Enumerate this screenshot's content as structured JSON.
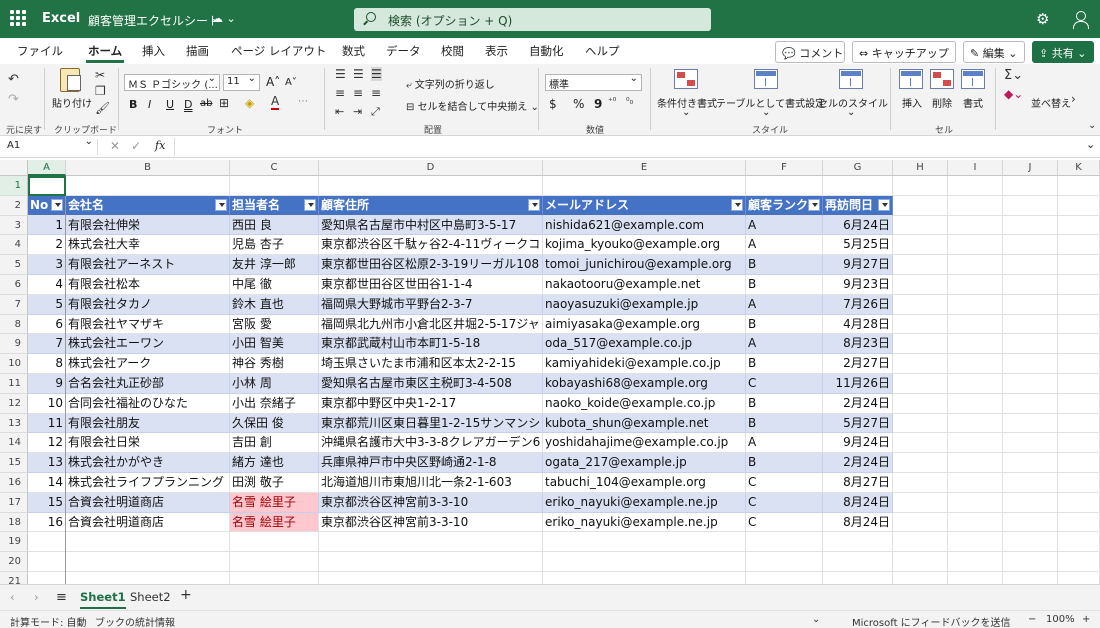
{
  "titlebar": {
    "app_name": "Excel",
    "doc_title": "顧客管理エクセルシート",
    "search_placeholder": "検索 (オプション + Q)",
    "icons": [
      "waffle-icon",
      "cloud-save-icon",
      "chevron-down-icon",
      "search-icon",
      "gear-icon",
      "user-icon"
    ]
  },
  "menu": {
    "items": [
      "ファイル",
      "ホーム",
      "挿入",
      "描画",
      "ページ レイアウト",
      "数式",
      "データ",
      "校閲",
      "表示",
      "自動化",
      "ヘルプ"
    ],
    "active": "ホーム",
    "comment_label": "コメント",
    "catchup_label": "キャッチアップ",
    "edit_label": "編集",
    "share_label": "共有"
  },
  "ribbon": {
    "undo_group": "元に戻す",
    "paste_label": "貼り付け",
    "clipboard_group": "クリップボード",
    "font_name": "ＭＳ Ｐゴシック (...",
    "font_size": "11",
    "font_group": "フォント",
    "wrap_text": "文字列の折り返し",
    "merge_center": "セルを結合して中央揃え",
    "alignment_group": "配置",
    "number_format": "標準",
    "number_group": "数値",
    "cond_format": "条件付き書式",
    "format_table": "テーブルとして書式設定",
    "cell_styles": "セルのスタイル",
    "style_group": "スタイル",
    "insert": "挿入",
    "delete": "削除",
    "format": "書式",
    "cells_group": "セル",
    "sort_filter": "並べ替え",
    "font_buttons": [
      "B",
      "I",
      "U",
      "D",
      "ab"
    ],
    "number_buttons": [
      "$",
      "%",
      "9"
    ]
  },
  "formula_bar": {
    "name_box": "A1",
    "fx": "fx",
    "content": ""
  },
  "columns": [
    {
      "letter": "A",
      "header": "No"
    },
    {
      "letter": "B",
      "header": "会社名"
    },
    {
      "letter": "C",
      "header": "担当者名"
    },
    {
      "letter": "D",
      "header": "顧客住所"
    },
    {
      "letter": "E",
      "header": "メールアドレス"
    },
    {
      "letter": "F",
      "header": "顧客ランク"
    },
    {
      "letter": "G",
      "header": "再訪問日"
    },
    {
      "letter": "H",
      "header": ""
    },
    {
      "letter": "I",
      "header": ""
    },
    {
      "letter": "J",
      "header": ""
    },
    {
      "letter": "K",
      "header": ""
    }
  ],
  "row_numbers": [
    "1",
    "2",
    "3",
    "4",
    "5",
    "6",
    "7",
    "8",
    "9",
    "10",
    "11",
    "12",
    "13",
    "14",
    "15",
    "16",
    "17",
    "18",
    "19",
    "20",
    "21"
  ],
  "rows": [
    {
      "no": "1",
      "company": "有限会社伸栄",
      "contact": "西田 良",
      "address": "愛知県名古屋市中村区中島町3-5-17",
      "email": "nishida621@example.com",
      "rank": "A",
      "date": "6月24日"
    },
    {
      "no": "2",
      "company": "株式会社大幸",
      "contact": "児島 杏子",
      "address": "東京都渋谷区千駄ヶ谷2-4-11ヴィークコ",
      "email": "kojima_kyouko@example.org",
      "rank": "A",
      "date": "5月25日"
    },
    {
      "no": "3",
      "company": "有限会社アーネスト",
      "contact": "友井 淳一郎",
      "address": "東京都世田谷区松原2-3-19リーガル108",
      "email": "tomoi_junichirou@example.org",
      "rank": "B",
      "date": "9月27日"
    },
    {
      "no": "4",
      "company": "有限会社松本",
      "contact": "中尾 徹",
      "address": "東京都世田谷区世田谷1-1-4",
      "email": "nakaotooru@example.net",
      "rank": "B",
      "date": "9月23日"
    },
    {
      "no": "5",
      "company": "有限会社タカノ",
      "contact": "鈴木 直也",
      "address": "福岡県大野城市平野台2-3-7",
      "email": "naoyasuzuki@example.jp",
      "rank": "A",
      "date": "7月26日"
    },
    {
      "no": "6",
      "company": "有限会社ヤマザキ",
      "contact": "宮阪 愛",
      "address": "福岡県北九州市小倉北区井堀2-5-17ジャ",
      "email": "aimiyasaka@example.org",
      "rank": "B",
      "date": "4月28日"
    },
    {
      "no": "7",
      "company": "株式会社エーワン",
      "contact": "小田 智美",
      "address": "東京都武蔵村山市本町1-5-18",
      "email": "oda_517@example.co.jp",
      "rank": "A",
      "date": "8月23日"
    },
    {
      "no": "8",
      "company": "株式会社アーク",
      "contact": "神谷 秀樹",
      "address": "埼玉県さいたま市浦和区本太2-2-15",
      "email": "kamiyahideki@example.co.jp",
      "rank": "B",
      "date": "2月27日"
    },
    {
      "no": "9",
      "company": "合名会社丸正砂部",
      "contact": "小林 周",
      "address": "愛知県名古屋市東区主税町3-4-508",
      "email": "kobayashi68@example.org",
      "rank": "C",
      "date": "11月26日"
    },
    {
      "no": "10",
      "company": "合同会社福祉のひなた",
      "contact": "小出 奈緒子",
      "address": "東京都中野区中央1-2-17",
      "email": "naoko_koide@example.co.jp",
      "rank": "B",
      "date": "2月24日"
    },
    {
      "no": "11",
      "company": "有限会社朋友",
      "contact": "久保田 俊",
      "address": "東京都荒川区東日暮里1-2-15サンマンシ",
      "email": "kubota_shun@example.net",
      "rank": "B",
      "date": "5月27日"
    },
    {
      "no": "12",
      "company": "有限会社日栄",
      "contact": "吉田 創",
      "address": "沖縄県名護市大中3-3-8クレアガーデン6",
      "email": "yoshidahajime@example.co.jp",
      "rank": "A",
      "date": "9月24日"
    },
    {
      "no": "13",
      "company": "株式会社かがやき",
      "contact": "緒方 達也",
      "address": "兵庫県神戸市中央区野崎通2-1-8",
      "email": "ogata_217@example.jp",
      "rank": "B",
      "date": "2月24日"
    },
    {
      "no": "14",
      "company": "株式会社ライフプランニング",
      "contact": "田渕 敬子",
      "address": "北海道旭川市東旭川北一条2-1-603",
      "email": "tabuchi_104@example.org",
      "rank": "C",
      "date": "8月27日"
    },
    {
      "no": "15",
      "company": "合資会社明道商店",
      "contact": "名雪 絵里子",
      "address": "東京都渋谷区神宮前3-3-10",
      "email": "eriko_nayuki@example.ne.jp",
      "rank": "C",
      "date": "8月24日",
      "dup": true
    },
    {
      "no": "16",
      "company": "合資会社明道商店",
      "contact": "名雪 絵里子",
      "address": "東京都渋谷区神宮前3-3-10",
      "email": "eriko_nayuki@example.ne.jp",
      "rank": "C",
      "date": "8月24日",
      "dup": true,
      "outside": true
    }
  ],
  "sheets": [
    "Sheet1",
    "Sheet2"
  ],
  "active_sheet": "Sheet1",
  "status": {
    "calc_mode": "計算モード: 自動",
    "workbook_stats": "ブックの統計情報",
    "feedback": "Microsoft にフィードバックを送信",
    "zoom": "100%"
  },
  "colors": {
    "brand": "#217346",
    "table_header": "#4472c4",
    "table_band": "#d9e1f2",
    "dup_fill": "#ffc7ce",
    "dup_text": "#9c0006"
  }
}
